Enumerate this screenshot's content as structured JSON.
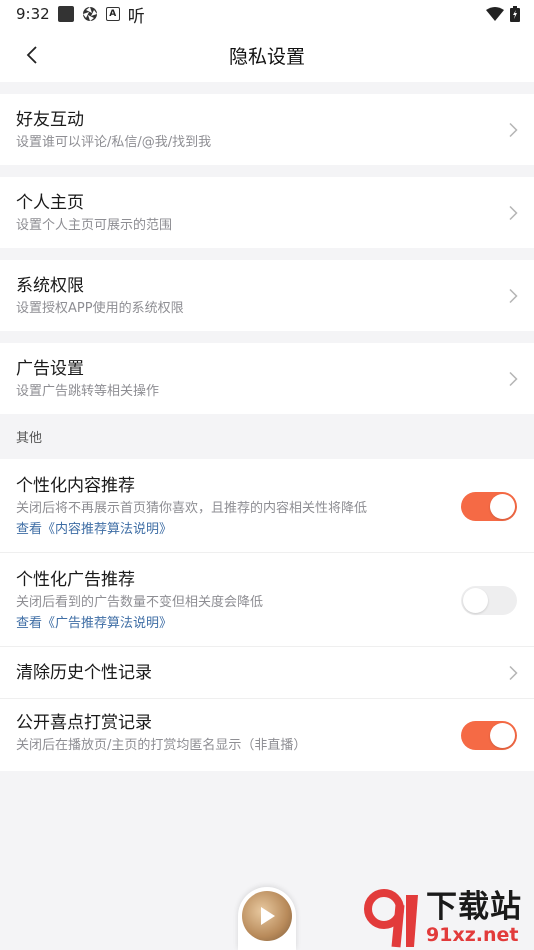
{
  "status_bar": {
    "time": "9:32",
    "listen_label": "听"
  },
  "nav": {
    "title": "隐私设置"
  },
  "rows": [
    {
      "title": "好友互动",
      "subtitle": "设置谁可以评论/私信/@我/找到我"
    },
    {
      "title": "个人主页",
      "subtitle": "设置个人主页可展示的范围"
    },
    {
      "title": "系统权限",
      "subtitle": "设置授权APP使用的系统权限"
    },
    {
      "title": "广告设置",
      "subtitle": "设置广告跳转等相关操作"
    }
  ],
  "section_other": "其他",
  "toggles": [
    {
      "title": "个性化内容推荐",
      "subtitle": "关闭后将不再展示首页猜你喜欢，且推荐的内容相关性将降低",
      "link": "查看《内容推荐算法说明》",
      "state": "on"
    },
    {
      "title": "个性化广告推荐",
      "subtitle": "关闭后看到的广告数量不变但相关度会降低",
      "link": "查看《广告推荐算法说明》",
      "state": "off"
    }
  ],
  "clear_history": {
    "title": "清除历史个性记录"
  },
  "public_reward": {
    "title": "公开喜点打赏记录",
    "subtitle": "关闭后在播放页/主页的打赏均匿名显示（非直播）",
    "state": "on"
  },
  "watermark": {
    "brand": "下载站",
    "domain": "91xz.net"
  },
  "colors": {
    "accent": "#f56a45",
    "link": "#3f6ea5",
    "background": "#f4f4f6"
  }
}
